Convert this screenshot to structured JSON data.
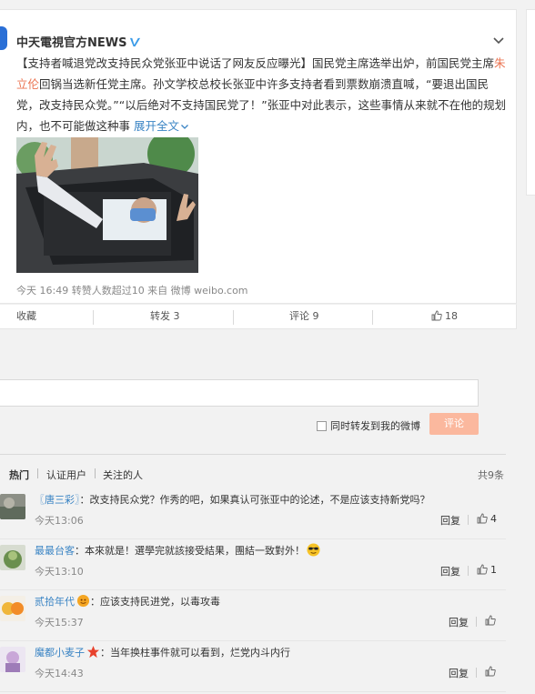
{
  "post": {
    "author": "中天電視官方NEWS",
    "text_before_link": "【支持者喊退党改支持民众党张亚中说话了网友反应曝光】国民党主席选举出炉，前国民党主席",
    "link_name": "朱立伦",
    "text_after_link": "回锅当选新任党主席。孙文学校总校长张亚中许多支持者看到票数崩溃直喊，“要退出国民党，改支持民众党。”“以后绝对不支持国民党了！”张亚中对此表示，这些事情从来就不在他的规划内，也不可能做这种事",
    "expand_label": "展开全文",
    "meta": "今天 16:49 转赞人数超过10  来自 微博 weibo.com"
  },
  "actions": {
    "favorite": "收藏",
    "repost": "转发 3",
    "comment": "评论 9",
    "like": "18"
  },
  "compose": {
    "share_label": "同时转发到我的微博",
    "submit_label": "评论"
  },
  "filters": {
    "hot": "热门",
    "verified": "认证用户",
    "following": "关注的人",
    "total": "共9条"
  },
  "comments": [
    {
      "name": "〖唐三彩〗",
      "text": "：改支持民众党？作秀的吧，如果真认可张亚中的论述，不是应该支持新党吗？",
      "time": "今天13:06",
      "reply": "回复",
      "likes": "4"
    },
    {
      "name": "最最台客",
      "text": "：本來就是！選學完就該接受結果，團結一致對外！",
      "time": "今天13:10",
      "reply": "回复",
      "likes": "1"
    },
    {
      "name": "贰拾年代",
      "text": "：应该支持民进党，以毒攻毒",
      "time": "今天15:37",
      "reply": "回复",
      "likes": ""
    },
    {
      "name": "魔都小麦子",
      "text": "：当年换柱事件就可以看到，烂党内斗内行",
      "time": "今天14:43",
      "reply": "回复",
      "likes": ""
    }
  ],
  "colors": {
    "link_blue": "#3a84c4",
    "accent_orange": "#eb7350",
    "button_disabled": "#fbb89e"
  }
}
